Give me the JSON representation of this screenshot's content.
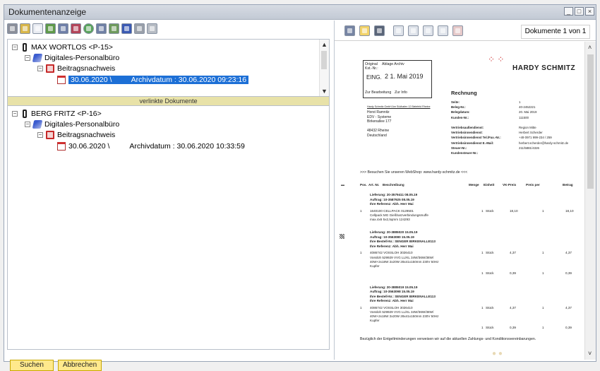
{
  "window": {
    "title": "Dokumentenanzeige"
  },
  "tree1": {
    "person": "MAX WORTLOS <P-15>",
    "office": "Digitales-Personalbüro",
    "category": "Beitragsnachweis",
    "doc_date": "30.06.2020 \\",
    "doc_archive": "Archivdatum : 30.06.2020 09:23:16"
  },
  "separator": {
    "label": "verlinkte Dokumente"
  },
  "tree2": {
    "person": "BERG FRITZ <P-16>",
    "office": "Digitales-Personalbüro",
    "category": "Beitragsnachweis",
    "doc_date": "30.06.2020 \\",
    "doc_archive": "Archivdatum : 30.06.2020 10:33:59"
  },
  "buttons": {
    "search": "Suchen",
    "cancel": "Abbrechen"
  },
  "viewer": {
    "page_info": "Dokumente 1 von 1"
  },
  "invoice": {
    "stamp_original": "Original",
    "stamp_ablage": "Ablage Archiv",
    "stamp_kst": "Kst.-Nr.:",
    "stamp_eing": "EING.",
    "stamp_date": "2 1. Mai 2019",
    "stamp_bearb": "Zur Bearbeitung",
    "stamp_info": "Zur Info",
    "brand": "HARDY SCHMITZ",
    "doc_title": "Rechnung",
    "sender_line": "Hardy Schmitz GmbH Am Südhafen 12 Bielefeld Rheine",
    "recipient": [
      "Horst Ramnitz",
      "EDV - Systeme",
      "Birkenallee 177",
      "",
      "48432 Rheine",
      "Deutschland"
    ],
    "meta_labels": [
      "Seite:",
      "Beleg-Nr.:",
      "Belegdatum:",
      "Kunden-Nr.:",
      "",
      "Vertriebsaußendienst:",
      "Vertriebsinnendienst:",
      "Vertriebsinnendienst Tel./Fax.-Nr.:",
      "Vertriebsinnendienst E.-Mail:",
      "Steuer-Nr.:",
      "Kundensteuer-Nr.:"
    ],
    "meta_values": [
      "1",
      "40-2452221",
      "20. Mai 2019",
      "111500",
      "",
      "Region Mitte",
      "Herbert Scherder",
      "+49 0971 999-234 / 259",
      "herbert.scherder@hardy-schmitz.de",
      "211/5881/4326",
      ""
    ],
    "webshop": ">>> Besuchen Sie unseren WebShop: www.hardy-schmitz.de <<<",
    "columns": [
      "Pos.",
      "Art. Nr.",
      "Beschreibung",
      "Menge",
      "Einheit",
      "VK-Preis",
      "Preis per",
      "Betrag"
    ],
    "blocks": [
      {
        "header": [
          "Lieferung: 20-3579411  08.05.19",
          "Auftrag: 10-3587925  08.05.19",
          "Ihre Referenz: Abh. Herr Mai"
        ],
        "items": [
          {
            "pos": "1",
            "art": "1640100   CELLPACK          0129501",
            "desc": [
              "Cellpack MG Gießharzverbindungsmuffe",
              "max.4x6 5x2,5qmm 124293"
            ],
            "menge": "1",
            "einheit": "Stück",
            "vk": "18,10",
            "per": "1",
            "betrag": "18,10"
          }
        ]
      },
      {
        "header": [
          "Lieferung: 20-3885020  15.05.19",
          "Auftrag: 10-3563080  15.05.19",
          "Ihre Bestell-Nr.: SENGER BIRKENALLE113",
          "Ihre Referenz: Abh. Herr Mai"
        ],
        "items": [
          {
            "pos": "1",
            "art": "4086742   VOSSLOH           3026410",
            "desc": [
              "Vossloh 529929 VVG LL/KL 34W/36W/38W/",
              "40W+2x18W 2x20W 28x41x150mm 230V 50Hz",
              "Kupfer"
            ],
            "menge": "1",
            "einheit": "Stück",
            "vk": "4,37",
            "per": "1",
            "betrag": "4,37"
          },
          {
            "pos": "",
            "art": "",
            "desc": [],
            "menge": "1",
            "einheit": "Stück",
            "vk": "0,39",
            "per": "1",
            "betrag": "0,39"
          }
        ]
      },
      {
        "header": [
          "Lieferung: 20-3885019  15.05.19",
          "Auftrag: 10-3563098  15.05.19",
          "Ihre Bestell-Nr.: SENGER BIRKENALLE113",
          "Ihre Referenz: Abh. Herr Mai"
        ],
        "items": [
          {
            "pos": "1",
            "art": "4086742   VOSSLOH           3026410",
            "desc": [
              "Vossloh 529929 VVG LL/KL 34W/36W/38W/",
              "40W+2x18W 2x20W 28x41x150mm 230V 50Hz",
              "Kupfer"
            ],
            "menge": "1",
            "einheit": "Stück",
            "vk": "4,37",
            "per": "1",
            "betrag": "4,37"
          },
          {
            "pos": "",
            "art": "",
            "desc": [],
            "menge": "1",
            "einheit": "Stück",
            "vk": "0,39",
            "per": "1",
            "betrag": "0,39"
          }
        ]
      }
    ],
    "footer": "Bezüglich der Entgeltminderungen verweisen wir auf die aktuellen Zahlungs- und Konditionsvereinbarungen."
  },
  "colors": {
    "selection": "#1c6fd6",
    "button": "#ffe98c",
    "separator": "#e8e2a8"
  }
}
